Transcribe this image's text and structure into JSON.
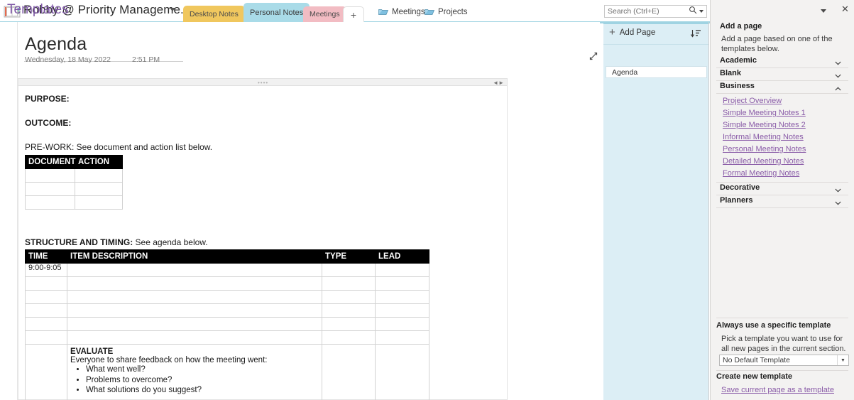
{
  "window": {
    "notebook_title": "Robby @ Priority Manageme...",
    "notebook_icon": "notebook-icon"
  },
  "section_tabs": [
    {
      "label": "Desktop Notes",
      "color": "#f0c75e",
      "active": false
    },
    {
      "label": "Personal Notes",
      "color": "#a9dbe8",
      "active": true
    },
    {
      "label": "Meetings",
      "color": "#f2bcc3",
      "active": false
    }
  ],
  "new_section_label": "+",
  "section_groups": [
    {
      "label": "Meetings",
      "icon": "section-group-icon"
    },
    {
      "label": "Projects",
      "icon": "section-group-icon"
    }
  ],
  "search": {
    "placeholder": "Search (Ctrl+E)",
    "value": "",
    "icon": "search-icon"
  },
  "page": {
    "title": "Agenda",
    "date": "Wednesday, 18 May 2022",
    "time": "2:51 PM",
    "expand_icon": "expand-diagonal-icon"
  },
  "note": {
    "purpose_label": "PURPOSE:",
    "outcome_label": "OUTCOME:",
    "prework_label": "PRE-WORK: See document and action list below.",
    "document_table": {
      "headers": [
        "DOCUMENT",
        "ACTION"
      ],
      "rows": [
        [
          "",
          ""
        ],
        [
          "",
          ""
        ],
        [
          "",
          ""
        ]
      ]
    },
    "structure_label_bold": "STRUCTURE AND TIMING:",
    "structure_label_rest": " See agenda below.",
    "agenda_table": {
      "headers": [
        "TIME",
        "ITEM DESCRIPTION",
        "TYPE",
        "LEAD"
      ],
      "rows": [
        [
          "9:00-9:05",
          "",
          "",
          ""
        ],
        [
          "",
          "",
          "",
          ""
        ],
        [
          "",
          "",
          "",
          ""
        ],
        [
          "",
          "",
          "",
          ""
        ],
        [
          "",
          "",
          "",
          ""
        ],
        [
          "",
          "",
          "",
          ""
        ]
      ],
      "evaluate_row": {
        "time": "",
        "title": "EVALUATE",
        "subtitle": "Everyone to share feedback on how the meeting went:",
        "bullets": [
          "What went well?",
          "Problems to overcome?",
          "What solutions do you suggest?"
        ],
        "type": "",
        "lead": ""
      }
    }
  },
  "page_list": {
    "add_page_label": "Add Page",
    "add_icon": "plus-icon",
    "sort_icon": "sort-icon",
    "pages": [
      {
        "label": "Agenda",
        "selected": true
      }
    ]
  },
  "templates": {
    "title": "Templates",
    "caret_icon": "chevron-down-icon",
    "close_icon": "close-icon",
    "add_a_page_heading": "Add a page",
    "add_a_page_desc": "Add a page based on one of the templates below.",
    "categories": [
      {
        "label": "Academic",
        "expanded": false,
        "chevron": "chevron-down-icon"
      },
      {
        "label": "Blank",
        "expanded": false,
        "chevron": "chevron-down-icon"
      },
      {
        "label": "Business",
        "expanded": true,
        "chevron": "chevron-up-icon"
      },
      {
        "label": "Decorative",
        "expanded": false,
        "chevron": "chevron-down-icon"
      },
      {
        "label": "Planners",
        "expanded": false,
        "chevron": "chevron-down-icon"
      }
    ],
    "business_templates": [
      "Project Overview",
      "Simple Meeting Notes 1",
      "Simple Meeting Notes 2",
      "Informal Meeting Notes",
      "Personal Meeting Notes",
      "Detailed Meeting Notes",
      "Formal Meeting Notes"
    ],
    "always_use_heading": "Always use a specific template",
    "always_use_desc": "Pick a template you want to use for all new pages in the current section.",
    "default_template_value": "No Default Template",
    "create_new_heading": "Create new template",
    "save_link": "Save current page as a template",
    "accent_color": "#7e57a6",
    "link_color": "#8a5ca8"
  }
}
